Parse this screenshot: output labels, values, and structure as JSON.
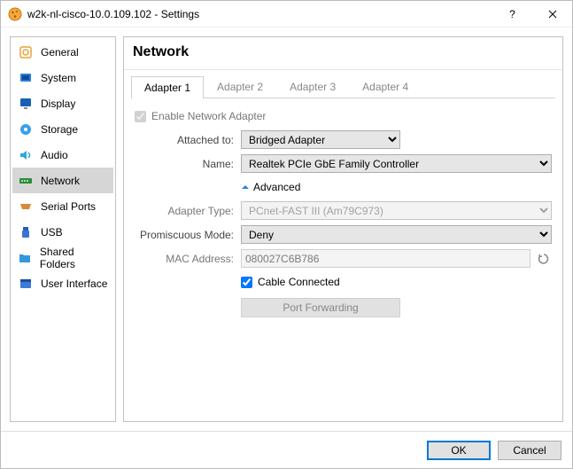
{
  "window": {
    "title": "w2k-nl-cisco-10.0.109.102 - Settings"
  },
  "sidebar": {
    "items": [
      {
        "label": "General"
      },
      {
        "label": "System"
      },
      {
        "label": "Display"
      },
      {
        "label": "Storage"
      },
      {
        "label": "Audio"
      },
      {
        "label": "Network"
      },
      {
        "label": "Serial Ports"
      },
      {
        "label": "USB"
      },
      {
        "label": "Shared Folders"
      },
      {
        "label": "User Interface"
      }
    ]
  },
  "main": {
    "title": "Network",
    "tabs": [
      "Adapter 1",
      "Adapter 2",
      "Adapter 3",
      "Adapter 4"
    ],
    "enable_label": "Enable Network Adapter",
    "attached_label": "Attached to:",
    "attached_value": "Bridged Adapter",
    "name_label": "Name:",
    "name_value": "Realtek PCIe GbE Family Controller",
    "advanced_label": "Advanced",
    "adapter_type_label": "Adapter Type:",
    "adapter_type_value": "PCnet-FAST III (Am79C973)",
    "promiscuous_label": "Promiscuous Mode:",
    "promiscuous_value": "Deny",
    "mac_label": "MAC Address:",
    "mac_value": "080027C6B786",
    "cable_label": "Cable Connected",
    "port_fwd_label": "Port Forwarding"
  },
  "footer": {
    "ok": "OK",
    "cancel": "Cancel"
  }
}
